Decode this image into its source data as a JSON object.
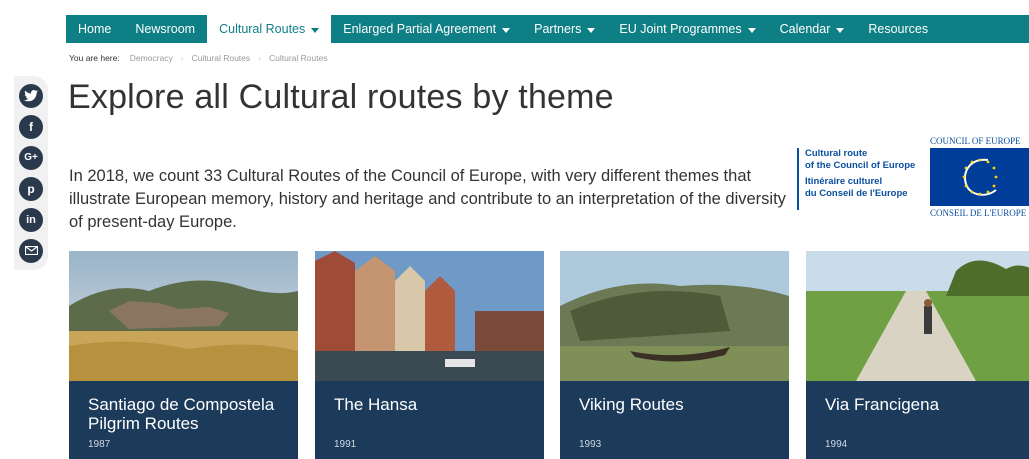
{
  "nav": {
    "items": [
      {
        "label": "Home",
        "dropdown": false,
        "active": false
      },
      {
        "label": "Newsroom",
        "dropdown": false,
        "active": false
      },
      {
        "label": "Cultural Routes",
        "dropdown": true,
        "active": true
      },
      {
        "label": "Enlarged Partial Agreement",
        "dropdown": true,
        "active": false
      },
      {
        "label": "Partners",
        "dropdown": true,
        "active": false
      },
      {
        "label": "EU Joint Programmes",
        "dropdown": true,
        "active": false
      },
      {
        "label": "Calendar",
        "dropdown": true,
        "active": false
      },
      {
        "label": "Resources",
        "dropdown": false,
        "active": false
      }
    ]
  },
  "breadcrumb": {
    "lead": "You are here:",
    "items": [
      "Democracy",
      "Cultural Routes",
      "Cultural Routes"
    ]
  },
  "social": [
    "twitter-icon",
    "facebook-icon",
    "google-plus-icon",
    "pinterest-icon",
    "linkedin-icon",
    "email-icon"
  ],
  "page": {
    "title": "Explore all Cultural routes by theme",
    "intro": "In 2018, we count 33 Cultural Routes of the Council of Europe, with very different themes that illustrate European memory, history and heritage and contribute to an interpretation of the diversity of present-day Europe."
  },
  "logos": {
    "cultural_route": {
      "en1": "Cultural route",
      "en2": "of the Council of Europe",
      "fr1": "Itinéraire culturel",
      "fr2": "du Conseil de l'Europe"
    },
    "coe": {
      "top": "COUNCIL OF EUROPE",
      "bottom": "CONSEIL DE L'EUROPE"
    }
  },
  "cards": [
    {
      "name": "Santiago de Compostela Pilgrim Routes",
      "year": "1987"
    },
    {
      "name": "The Hansa",
      "year": "1991"
    },
    {
      "name": "Viking Routes",
      "year": "1993"
    },
    {
      "name": "Via Francigena",
      "year": "1994"
    }
  ],
  "colors": {
    "nav": "#0f7f86",
    "card": "#1c3a5a",
    "logo_blue": "#0a4fa0",
    "social": "#2a3a4c"
  }
}
